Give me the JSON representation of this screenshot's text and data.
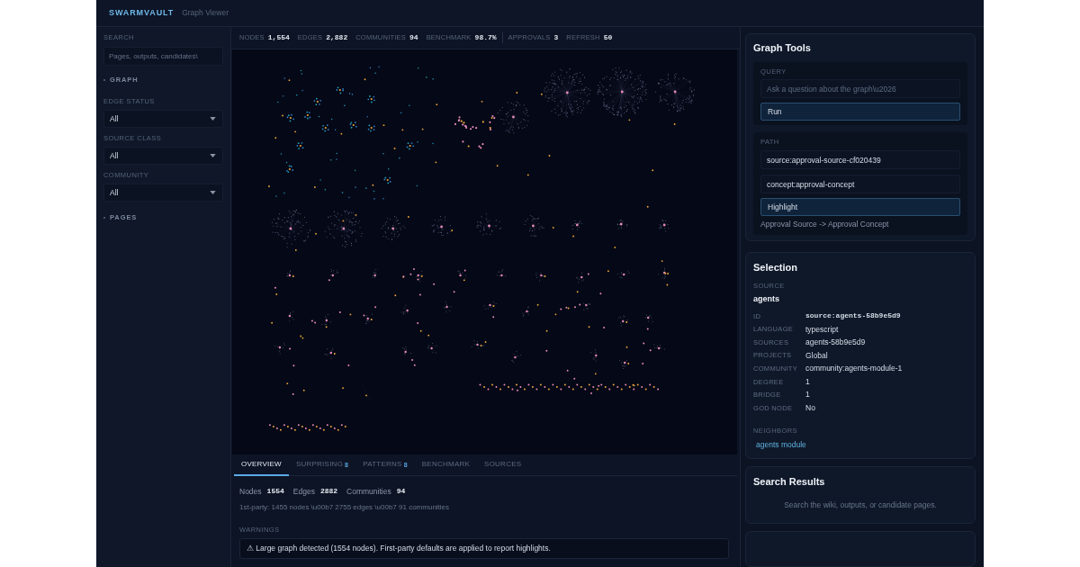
{
  "header": {
    "brand": "SWARMVAULT",
    "subtitle": "Graph Viewer"
  },
  "sidebar": {
    "search": {
      "label": "SEARCH",
      "placeholder": "Pages, outputs, candidates\\"
    },
    "sections": [
      {
        "title": "GRAPH",
        "filters": [
          {
            "label": "EDGE STATUS",
            "value": "All"
          },
          {
            "label": "SOURCE CLASS",
            "value": "All"
          },
          {
            "label": "COMMUNITY",
            "value": "All"
          }
        ]
      },
      {
        "title": "PAGES"
      }
    ]
  },
  "stat_groups": [
    {
      "items": [
        {
          "label": "NODES",
          "value": "1,554"
        },
        {
          "label": "EDGES",
          "value": "2,882"
        },
        {
          "label": "COMMUNITIES",
          "value": "94"
        },
        {
          "label": "BENCHMARK",
          "value": "98.7%"
        }
      ]
    },
    {
      "items": [
        {
          "label": "APPROVALS",
          "value": "3"
        },
        {
          "label": "REFRESH",
          "value": "50"
        }
      ]
    }
  ],
  "bottom_panel": {
    "tabs": [
      {
        "label": "OVERVIEW",
        "selected": true
      },
      {
        "label": "SURPRISING",
        "count": "8",
        "selected": false
      },
      {
        "label": "PATTERNS",
        "count": "8",
        "selected": false
      },
      {
        "label": "BENCHMARK",
        "selected": false
      },
      {
        "label": "SOURCES",
        "selected": false
      }
    ],
    "totals": [
      {
        "label": "Nodes",
        "value": "1554"
      },
      {
        "label": "Edges",
        "value": "2882"
      },
      {
        "label": "Communities",
        "value": "94"
      }
    ],
    "first_party": "1st-party: 1455 nodes \\u00b7 2755 edges \\u00b7 91 communities",
    "warnings_label": "WARNINGS",
    "warnings": [
      "⚠ Large graph detected (1554 nodes). First-party defaults are applied to report highlights."
    ]
  },
  "graph_tools": {
    "title": "Graph Tools",
    "query": {
      "label": "QUERY",
      "placeholder": "Ask a question about the graph\\u2026",
      "button": "Run"
    },
    "path": {
      "label": "PATH",
      "from": "source:approval-source-cf020439",
      "to": "concept:approval-concept",
      "button": "Highlight",
      "result": "Approval Source -> Approval Concept"
    }
  },
  "selection": {
    "title": "Selection",
    "type_label": "SOURCE",
    "name": "agents",
    "fields": [
      {
        "key": "ID",
        "value": "source:agents-58b9e5d9",
        "kind": "code"
      },
      {
        "key": "LANGUAGE",
        "value": "typescript",
        "kind": "text"
      },
      {
        "key": "SOURCES",
        "value": "agents-58b9e5d9",
        "kind": "text"
      },
      {
        "key": "PROJECTS",
        "value": "Global",
        "kind": "text"
      },
      {
        "key": "COMMUNITY",
        "value": "community:agents-module-1",
        "kind": "text"
      },
      {
        "key": "DEGREE",
        "value": "1",
        "kind": "text"
      },
      {
        "key": "BRIDGE",
        "value": "1",
        "kind": "text"
      },
      {
        "key": "GOD NODE",
        "value": "No",
        "kind": "text"
      }
    ],
    "neighbors_label": "NEIGHBORS",
    "neighbors": [
      "agents module"
    ]
  },
  "search_results": {
    "title": "Search Results",
    "empty_message": "Search the wiki, outputs, or candidate pages."
  }
}
